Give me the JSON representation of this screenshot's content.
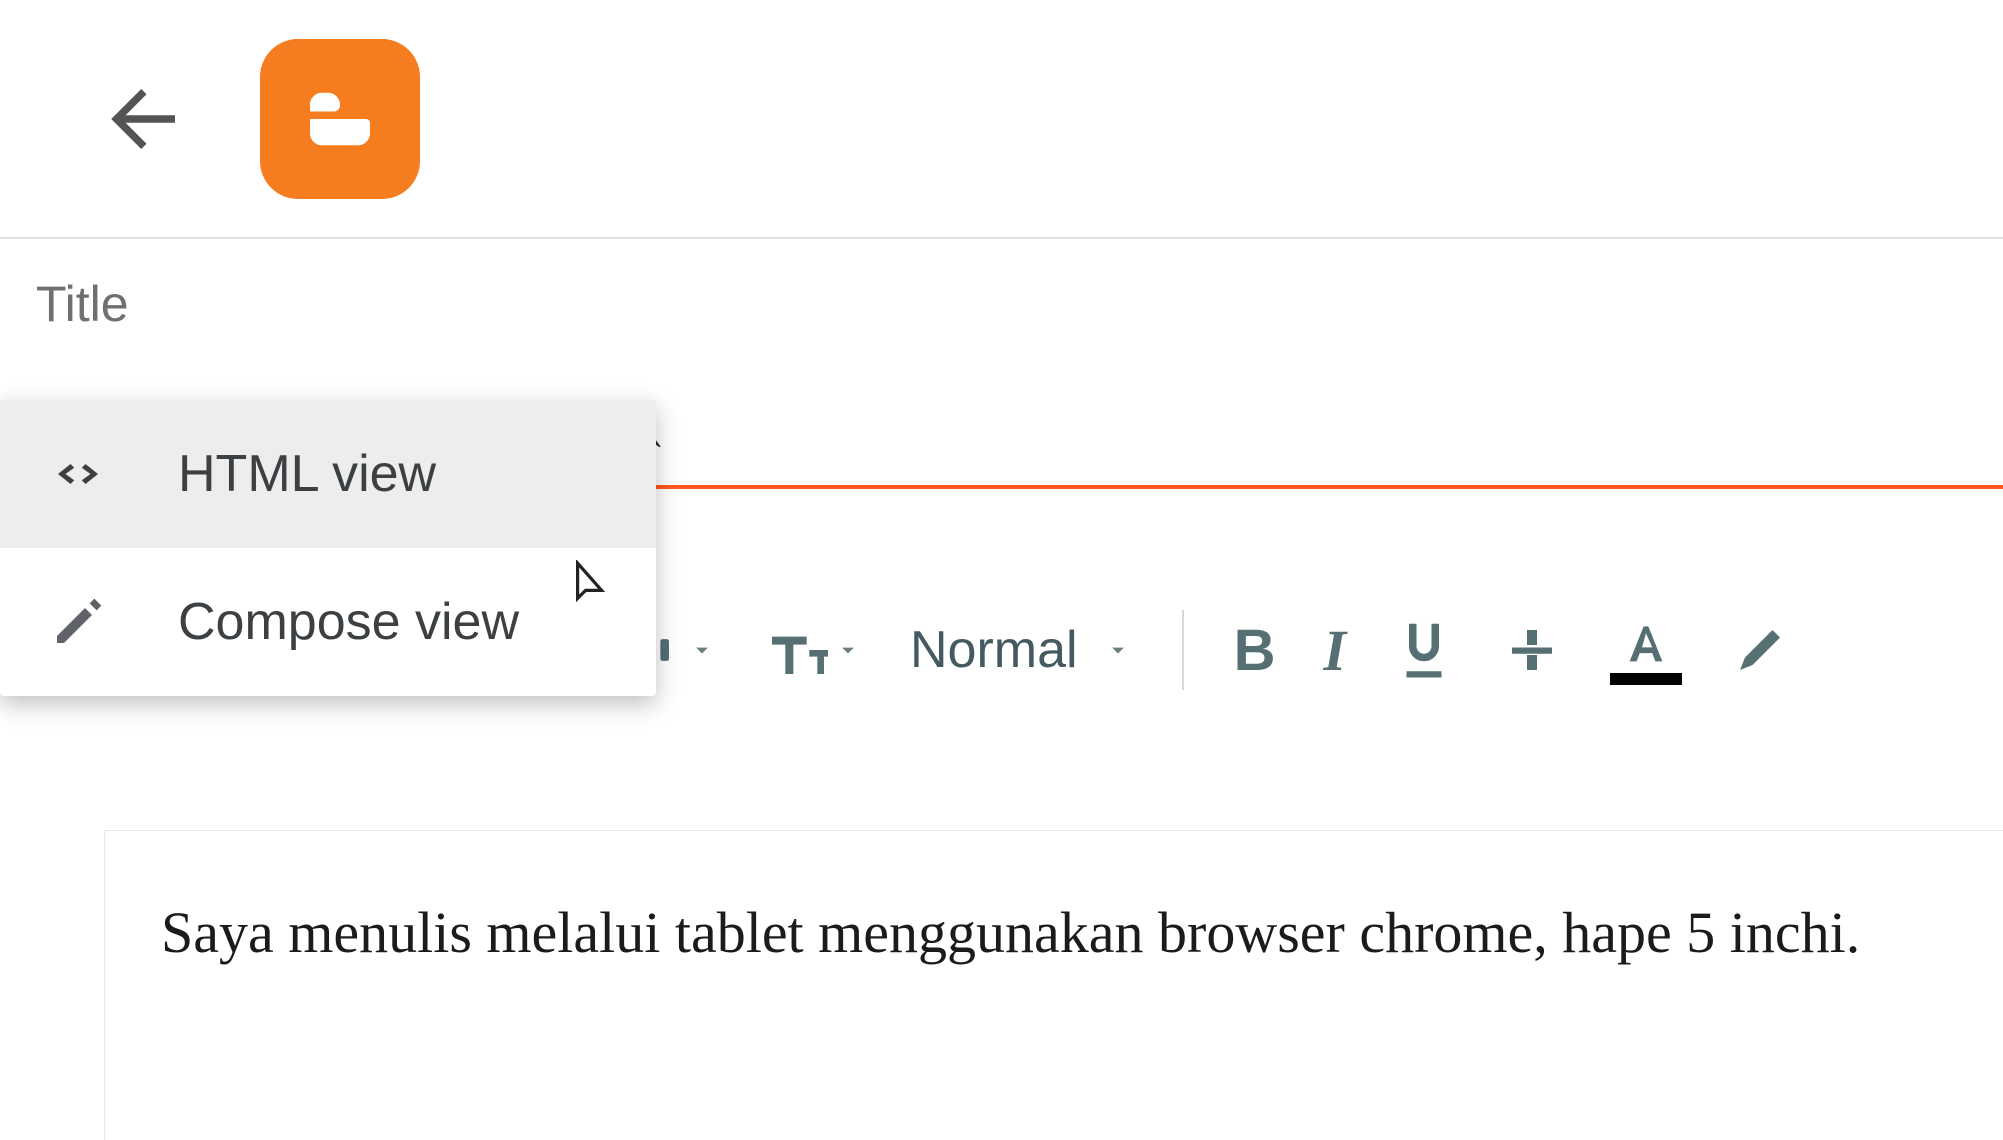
{
  "header": {
    "title_placeholder": "Title"
  },
  "view_menu": {
    "html_view": "HTML view",
    "compose_view": "Compose view"
  },
  "toolbar": {
    "paragraph_style": "Normal",
    "text_color": "#000000"
  },
  "editor": {
    "content": "Saya menulis melalui tablet menggunakan browser chrome, hape 5 inchi."
  }
}
